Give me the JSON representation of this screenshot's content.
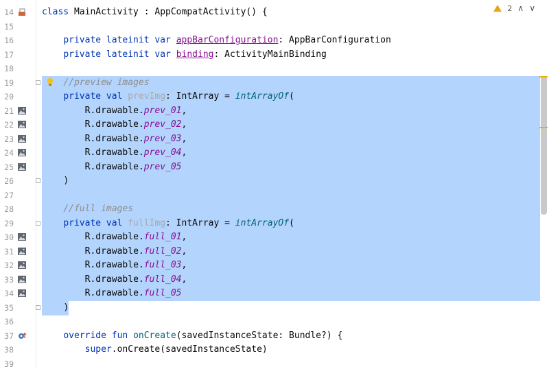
{
  "toolbar": {
    "warning_count": "2",
    "warning_icon": "warning-icon",
    "up_icon": "chevron-up-icon",
    "down_icon": "chevron-down-icon"
  },
  "lines": [
    {
      "num": "14",
      "text": "class MainActivity : AppCompatActivity() {"
    },
    {
      "num": "15",
      "text": ""
    },
    {
      "num": "16",
      "text": "    private lateinit var appBarConfiguration: AppBarConfiguration"
    },
    {
      "num": "17",
      "text": "    private lateinit var binding: ActivityMainBinding"
    },
    {
      "num": "18",
      "text": ""
    },
    {
      "num": "19",
      "text": "    //preview images"
    },
    {
      "num": "20",
      "text": "    private val prevImg: IntArray = intArrayOf("
    },
    {
      "num": "21",
      "text": "        R.drawable.prev_01,"
    },
    {
      "num": "22",
      "text": "        R.drawable.prev_02,"
    },
    {
      "num": "23",
      "text": "        R.drawable.prev_03,"
    },
    {
      "num": "24",
      "text": "        R.drawable.prev_04,"
    },
    {
      "num": "25",
      "text": "        R.drawable.prev_05"
    },
    {
      "num": "26",
      "text": "    )"
    },
    {
      "num": "27",
      "text": ""
    },
    {
      "num": "28",
      "text": "    //full images"
    },
    {
      "num": "29",
      "text": "    private val fullImg: IntArray = intArrayOf("
    },
    {
      "num": "30",
      "text": "        R.drawable.full_01,"
    },
    {
      "num": "31",
      "text": "        R.drawable.full_02,"
    },
    {
      "num": "32",
      "text": "        R.drawable.full_03,"
    },
    {
      "num": "33",
      "text": "        R.drawable.full_04,"
    },
    {
      "num": "34",
      "text": "        R.drawable.full_05"
    },
    {
      "num": "35",
      "text": "    )"
    },
    {
      "num": "36",
      "text": ""
    },
    {
      "num": "37",
      "text": "    override fun onCreate(savedInstanceState: Bundle?) {"
    },
    {
      "num": "38",
      "text": "        super.onCreate(savedInstanceState)"
    },
    {
      "num": "39",
      "text": ""
    }
  ],
  "tokens": {
    "l14": [
      "class",
      " MainActivity : AppCompatActivity() {"
    ],
    "l16": [
      "private lateinit var ",
      "appBarConfiguration",
      ": AppBarConfiguration"
    ],
    "l17": [
      "private lateinit var ",
      "binding",
      ": ActivityMainBinding"
    ],
    "l19": [
      "//preview images"
    ],
    "l20": [
      "private val ",
      "prevImg",
      ": IntArray = ",
      "intArrayOf",
      "("
    ],
    "l21": [
      "R.drawable.",
      "prev_01",
      ","
    ],
    "l22": [
      "R.drawable.",
      "prev_02",
      ","
    ],
    "l23": [
      "R.drawable.",
      "prev_03",
      ","
    ],
    "l24": [
      "R.drawable.",
      "prev_04",
      ","
    ],
    "l25": [
      "R.drawable.",
      "prev_05"
    ],
    "l26": [
      ")"
    ],
    "l28": [
      "//full images"
    ],
    "l29": [
      "private val ",
      "fullImg",
      ": IntArray = ",
      "intArrayOf",
      "("
    ],
    "l30": [
      "R.drawable.",
      "full_01",
      ","
    ],
    "l31": [
      "R.drawable.",
      "full_02",
      ","
    ],
    "l32": [
      "R.drawable.",
      "full_03",
      ","
    ],
    "l33": [
      "R.drawable.",
      "full_04",
      ","
    ],
    "l34": [
      "R.drawable.",
      "full_05"
    ],
    "l35": [
      ")"
    ],
    "l37": [
      "override fun ",
      "onCreate",
      "(savedInstanceState: Bundle?) {"
    ],
    "l38": [
      "super",
      ".onCreate(savedInstanceState)"
    ]
  },
  "colors": {
    "selection": "#b3d4fc",
    "keyword": "#0033b3",
    "property": "#871094",
    "comment": "#8c8c8c",
    "function": "#00627a",
    "warning": "#e8a317"
  }
}
